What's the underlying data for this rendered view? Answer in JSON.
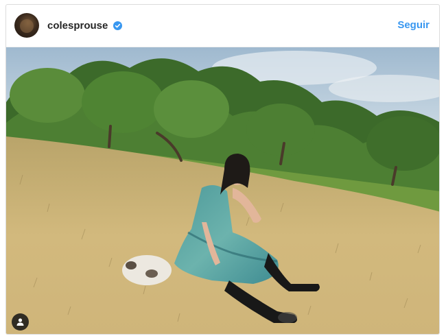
{
  "post": {
    "username": "colesprouse",
    "verified_icon": "verified-badge-icon",
    "follow_label": "Seguir",
    "tag_icon": "user-tag-icon",
    "image_description": "",
    "colors": {
      "follow": "#3897f0",
      "verified": "#3897f0",
      "username": "#262626"
    }
  }
}
